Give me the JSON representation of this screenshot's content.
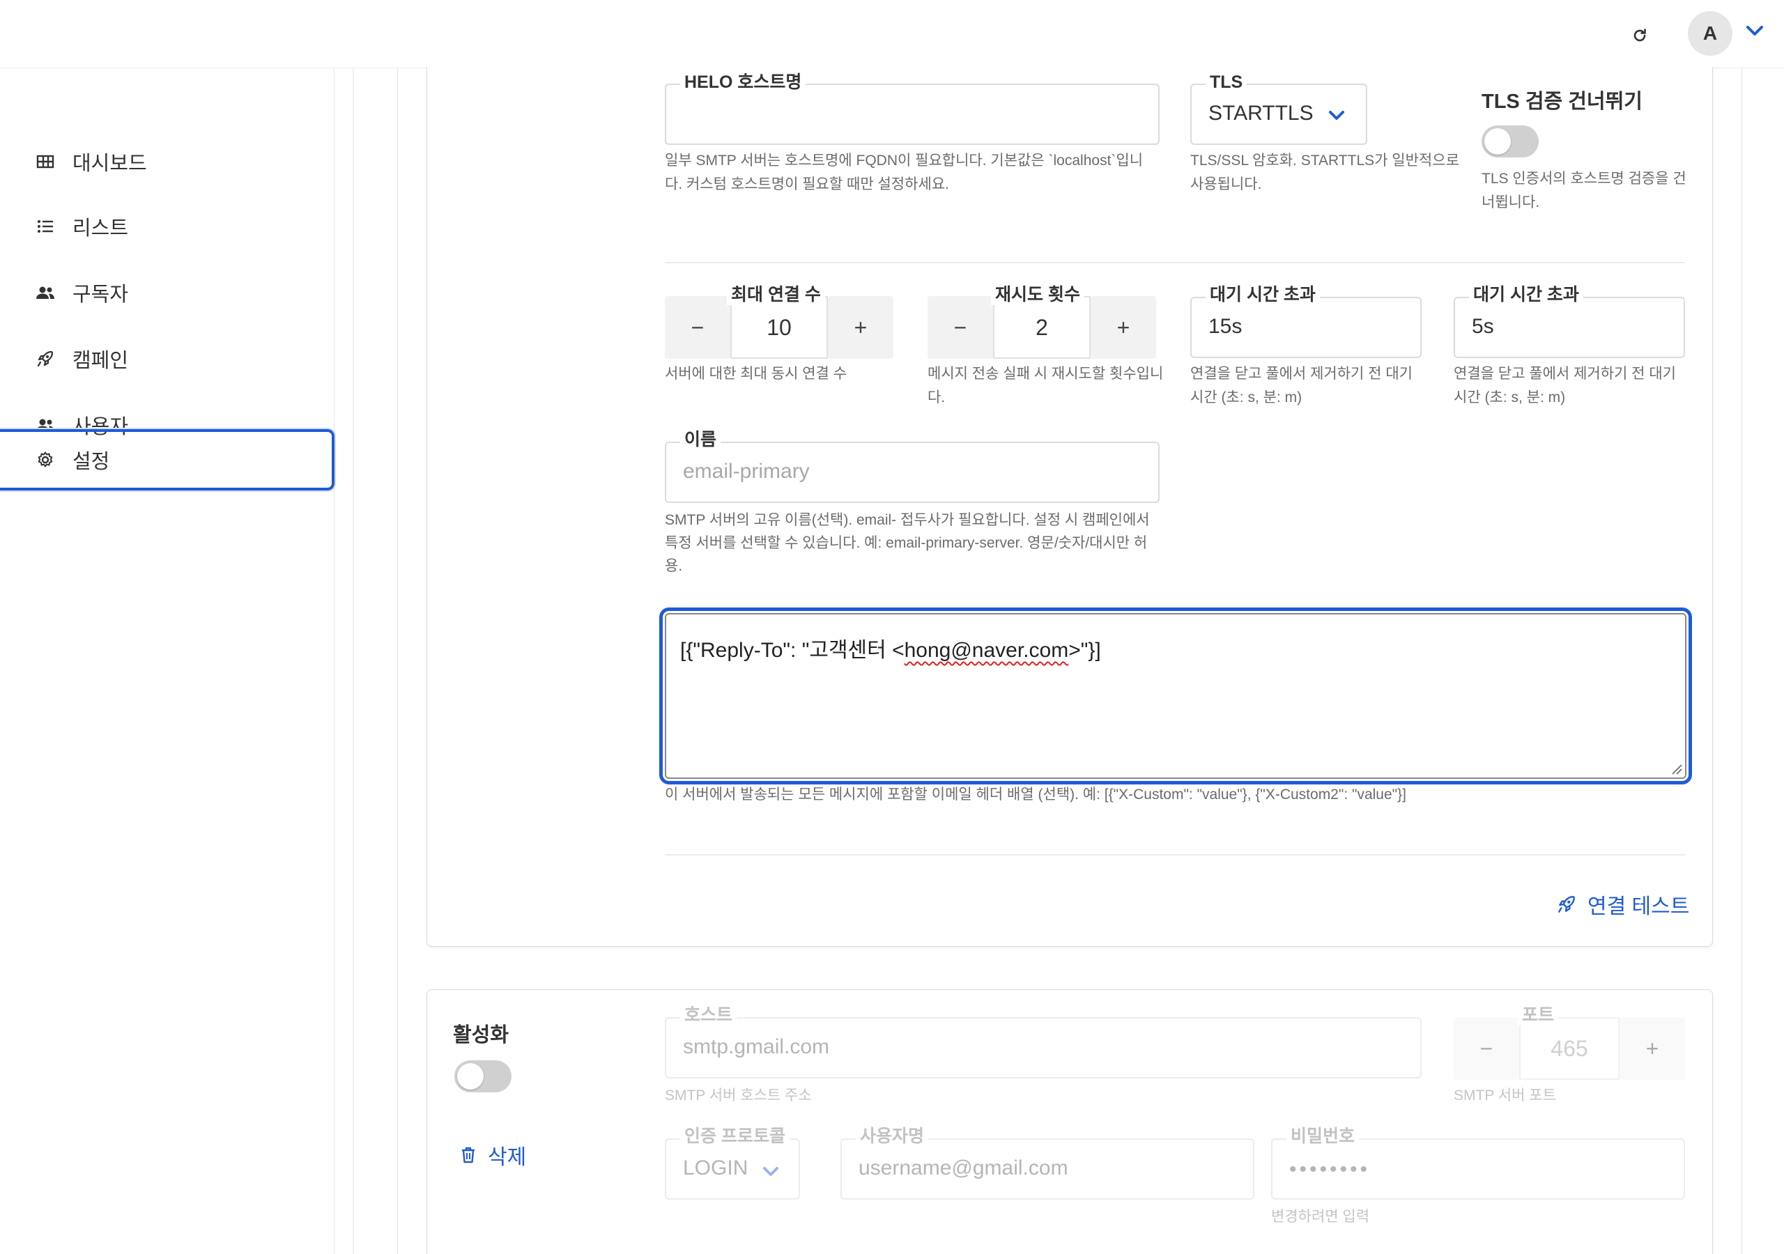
{
  "topbar": {
    "avatar_initial": "A",
    "refresh_icon": "refresh-icon",
    "chevron_icon": "chevron-down-icon"
  },
  "sidebar": {
    "items": [
      {
        "label": "대시보드",
        "icon": "dashboard-icon"
      },
      {
        "label": "리스트",
        "icon": "list-icon"
      },
      {
        "label": "구독자",
        "icon": "users-icon"
      },
      {
        "label": "캠페인",
        "icon": "rocket-icon"
      },
      {
        "label": "사용자",
        "icon": "users-icon"
      },
      {
        "label": "설정",
        "icon": "gear-icon",
        "active": true
      }
    ]
  },
  "smtp1": {
    "helo": {
      "label": "HELO 호스트명",
      "value": "",
      "help": "일부 SMTP 서버는 호스트명에 FQDN이 필요합니다. 기본값은 `localhost`입니다. 커스텀 호스트명이 필요할 때만 설정하세요."
    },
    "tls": {
      "label": "TLS",
      "value": "STARTTLS",
      "help": "TLS/SSL 암호화. STARTTLS가 일반적으로 사용됩니다."
    },
    "tls_skip": {
      "label": "TLS 검증 건너뛰기",
      "enabled": false,
      "help": "TLS 인증서의 호스트명 검증을 건너뜁니다."
    },
    "max_conns": {
      "label": "최대 연결 수",
      "value": "10",
      "help": "서버에 대한 최대 동시 연결 수"
    },
    "retries": {
      "label": "재시도 횟수",
      "value": "2",
      "help": "메시지 전송 실패 시 재시도할 횟수입니다."
    },
    "idle_timeout": {
      "label": "대기 시간 초과",
      "value": "15s",
      "help": "연결을 닫고 풀에서 제거하기 전 대기 시간 (초: s, 분: m)"
    },
    "wait_timeout": {
      "label": "대기 시간 초과",
      "value": "5s",
      "help": "연결을 닫고 풀에서 제거하기 전 대기 시간 (초: s, 분: m)"
    },
    "name": {
      "label": "이름",
      "placeholder": "email-primary",
      "help": "SMTP 서버의 고유 이름(선택). email- 접두사가 필요합니다. 설정 시 캠페인에서 특정 서버를 선택할 수 있습니다. 예: email-primary-server. 영문/숫자/대시만 허용."
    },
    "headers": {
      "value_prefix": "[{\"Reply-To\": \"고객센터 <",
      "value_email": "hong@naver.com",
      "value_suffix": ">\"}]",
      "help": "이 서버에서 발송되는 모든 메시지에 포함할 이메일 헤더 배열 (선택). 예: [{\"X-Custom\": \"value\"}, {\"X-Custom2\": \"value\"}]"
    },
    "test_button": "연결 테스트"
  },
  "smtp2": {
    "enabled_label": "활성화",
    "enabled": false,
    "delete_button": "삭제",
    "host": {
      "label": "호스트",
      "placeholder": "smtp.gmail.com",
      "help": "SMTP 서버 호스트 주소"
    },
    "port": {
      "label": "포트",
      "value": "465",
      "help": "SMTP 서버 포트"
    },
    "auth": {
      "label": "인증 프로토콜",
      "value": "LOGIN"
    },
    "username": {
      "label": "사용자명",
      "placeholder": "username@gmail.com"
    },
    "password": {
      "label": "비밀번호",
      "value": "••••••••",
      "help": "변경하려면 입력"
    }
  },
  "colors": {
    "accent": "#1f5bd6",
    "toggle_off": "#d0d0d0"
  },
  "stepper_symbols": {
    "minus": "−",
    "plus": "+"
  }
}
